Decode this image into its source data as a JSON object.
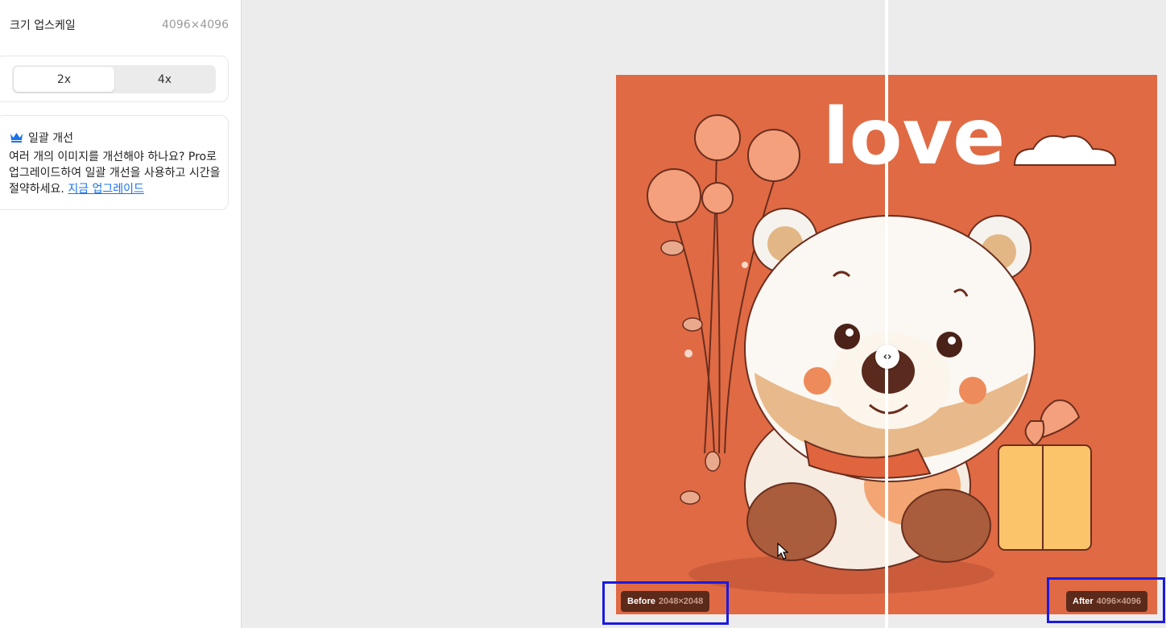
{
  "sidebar": {
    "size_label": "크기 업스케일",
    "size_value": "4096×4096",
    "scale_options": [
      "2x",
      "4x"
    ],
    "selected_scale": "2x",
    "promo": {
      "title": "일괄 개선",
      "body": "여러 개의 이미지를 개선해야 하나요? Pro로 업그레이드하여 일괄 개선을 사용하고 시간을 절약하세요.",
      "link": "지금 업그레이드",
      "icon": "crown-icon"
    }
  },
  "preview": {
    "image_text": "love",
    "before_label": "Before",
    "before_res": "2048×2048",
    "after_label": "After",
    "after_res": "4096×4096",
    "handle_glyph": "‹›"
  },
  "colors": {
    "accent": "#1a73e8",
    "image_bg": "#e06a44",
    "badge_bg": "#5c2a1a",
    "highlight": "#1a1ae0"
  }
}
